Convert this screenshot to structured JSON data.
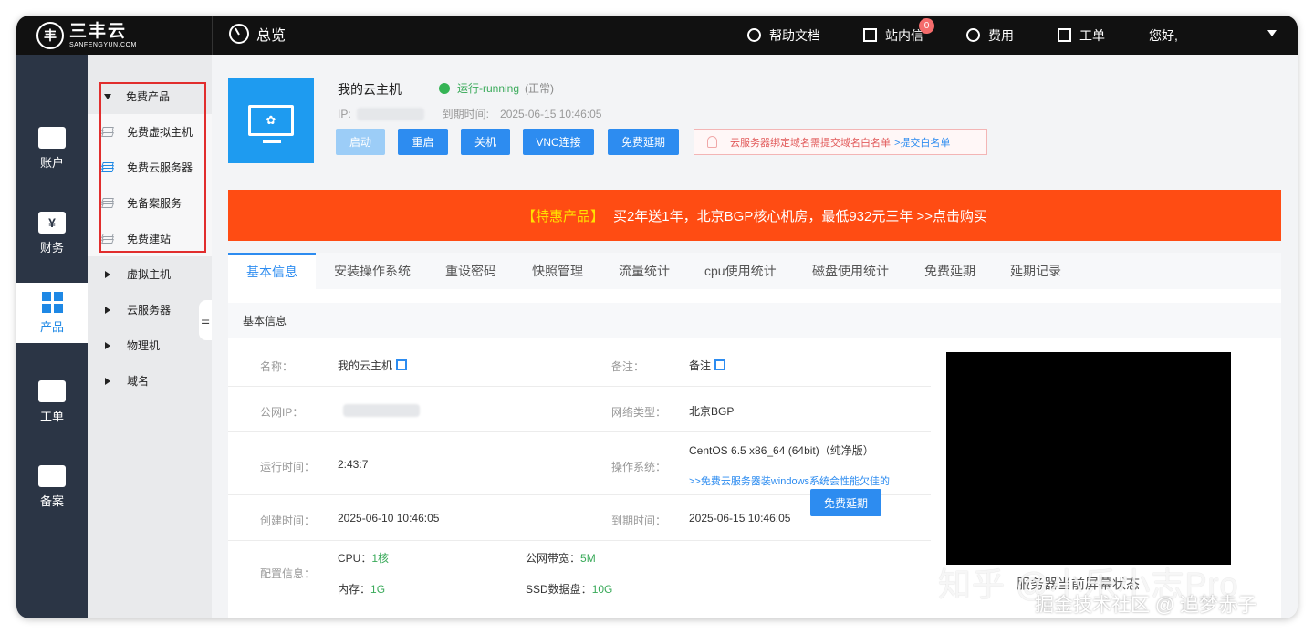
{
  "brand": {
    "logo_main": "三丰云",
    "logo_sub": "SANFENGYUN.COM",
    "logo_mark": "丰"
  },
  "header": {
    "overview": "总览",
    "help": "帮助文档",
    "messages": "站内信",
    "messages_badge": "0",
    "billing": "费用",
    "tickets": "工单",
    "greeting": "您好,"
  },
  "rail": {
    "items": [
      {
        "label": "账户",
        "icon": "id-card-icon"
      },
      {
        "label": "财务",
        "icon": "yen-icon",
        "glyph": "¥"
      },
      {
        "label": "产品",
        "icon": "grid-icon",
        "active": true
      },
      {
        "label": "工单",
        "icon": "bag-icon"
      },
      {
        "label": "备案",
        "icon": "badge-icon"
      }
    ]
  },
  "subnav": {
    "free_group": "免费产品",
    "free_items": [
      "免费虚拟主机",
      "免费云服务器",
      "免备案服务",
      "免费建站"
    ],
    "groups": [
      "虚拟主机",
      "云服务器",
      "物理机",
      "域名"
    ]
  },
  "vm": {
    "name": "我的云主机",
    "status": "运行-running",
    "status_note": "(正常)",
    "ip_label": "IP:",
    "expire_label": "到期时间:",
    "expire_time": "2025-06-15 10:46:05",
    "buttons": [
      "启动",
      "重启",
      "关机",
      "VNC连接",
      "免费延期"
    ],
    "notice": "云服务器绑定域名需提交域名白名单",
    "notice_link": ">提交白名单"
  },
  "promo": {
    "highlight": "【特惠产品】",
    "text": "买2年送1年，北京BGP核心机房，最低932元三年 >>点击购买"
  },
  "tabs": [
    "基本信息",
    "安装操作系统",
    "重设密码",
    "快照管理",
    "流量统计",
    "cpu使用统计",
    "磁盘使用统计",
    "免费延期",
    "延期记录"
  ],
  "info": {
    "section_title": "基本信息",
    "name_label": "名称：",
    "name_value": "我的云主机",
    "remark_label": "备注：",
    "remark_value": "备注",
    "ip_label": "公网IP：",
    "net_label": "网络类型：",
    "net_value": "北京BGP",
    "uptime_label": "运行时间：",
    "uptime_value": "2:43:7",
    "os_label": "操作系统：",
    "os_value": "CentOS 6.5 x86_64 (64bit)（纯净版）",
    "os_link": ">>免费云服务器装windows系统会性能欠佳的",
    "created_label": "创建时间：",
    "created_value": "2025-06-10 10:46:05",
    "expire_label": "到期时间：",
    "expire_value": "2025-06-15 10:46:05",
    "renew_button": "免费延期",
    "config_label": "配置信息：",
    "cpu_label": "CPU：",
    "cpu_value": "1核",
    "bw_label": "公网带宽：",
    "bw_value": "5M",
    "mem_label": "内存：",
    "mem_value": "1G",
    "ssd_label": "SSD数据盘：",
    "ssd_value": "10G",
    "screen_caption": "服务器当前屏幕状态"
  },
  "watermarks": {
    "zhihu": "知乎 @小乐小志Pro",
    "juejin": "掘金技术社区 @ 追梦赤子"
  },
  "colors": {
    "primary": "#2d8cf0",
    "promo": "#ff4c13",
    "running": "#35b455",
    "rail": "#2b3545"
  }
}
